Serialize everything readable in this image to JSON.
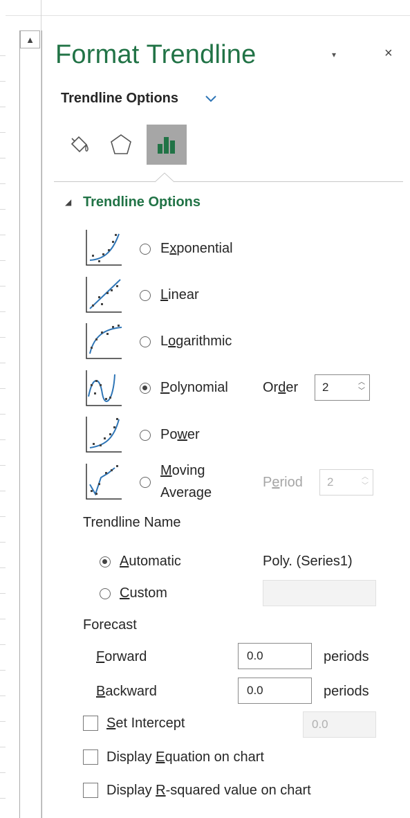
{
  "panel": {
    "title": "Format Trendline",
    "dropdown_glyph": "▾",
    "close_glyph": "×"
  },
  "options_header": {
    "label": "Trendline Options"
  },
  "tabs": [
    {
      "icon": "paint-bucket-icon",
      "active": false
    },
    {
      "icon": "pentagon-icon",
      "active": false
    },
    {
      "icon": "bar-chart-icon",
      "active": true
    }
  ],
  "section": {
    "title": "Trendline Options",
    "arrow": "◢"
  },
  "trend_types": [
    {
      "pre": "E",
      "ul": "x",
      "post": "ponential",
      "selected": false
    },
    {
      "pre": "",
      "ul": "L",
      "post": "inear",
      "selected": false
    },
    {
      "pre": "L",
      "ul": "o",
      "post": "garithmic",
      "selected": false
    },
    {
      "pre": "",
      "ul": "P",
      "post": "olynomial",
      "selected": true
    },
    {
      "pre": "Po",
      "ul": "w",
      "post": "er",
      "selected": false
    },
    {
      "pre": "",
      "ul": "M",
      "post": "oving",
      "line2": "Average",
      "selected": false
    }
  ],
  "order": {
    "pre": "Or",
    "ul": "d",
    "post": "er",
    "value": "2"
  },
  "period": {
    "pre": "P",
    "ul": "e",
    "post": "riod",
    "value": "2"
  },
  "trendline_name": {
    "label": "Trendline Name",
    "automatic": {
      "pre": "",
      "ul": "A",
      "post": "utomatic",
      "value": "Poly. (Series1)",
      "selected": true
    },
    "custom": {
      "pre": "",
      "ul": "C",
      "post": "ustom",
      "value": "",
      "selected": false
    }
  },
  "forecast": {
    "label": "Forecast",
    "forward": {
      "pre": "",
      "ul": "F",
      "post": "orward",
      "value": "0.0",
      "unit": "periods"
    },
    "backward": {
      "pre": "",
      "ul": "B",
      "post": "ackward",
      "value": "0.0",
      "unit": "periods"
    }
  },
  "checkboxes": {
    "set_intercept": {
      "pre": "",
      "ul": "S",
      "post": "et Intercept",
      "value": "0.0",
      "checked": false
    },
    "display_equation": {
      "pre": "Display ",
      "ul": "E",
      "post": "quation on chart",
      "checked": false
    },
    "display_rsquared": {
      "pre": "Display ",
      "ul": "R",
      "post": "-squared value on chart",
      "checked": false
    }
  },
  "colors": {
    "accent_green": "#217346",
    "trend_blue": "#2e75b6",
    "active_tab": "#a6a6a6"
  }
}
